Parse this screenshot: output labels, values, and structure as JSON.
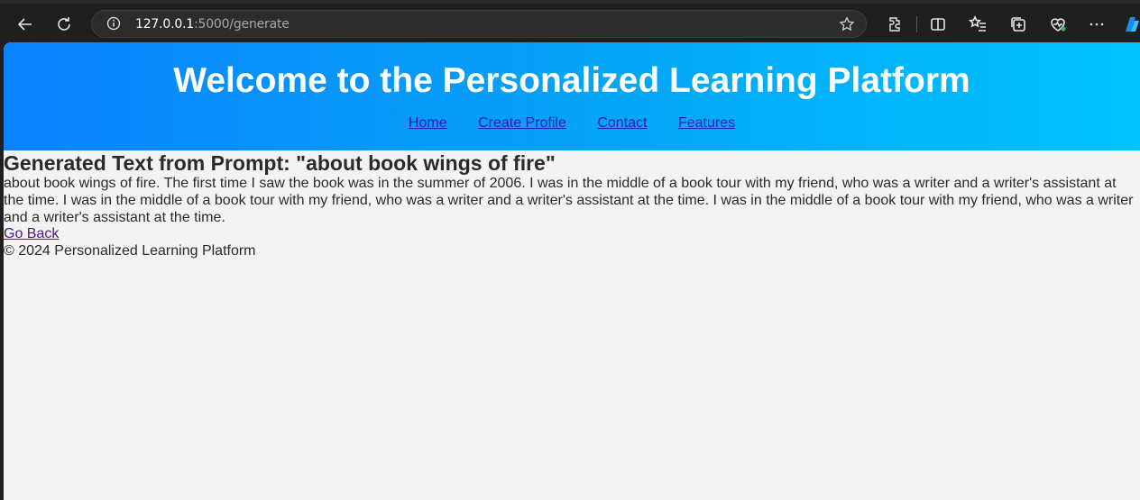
{
  "browser": {
    "url_host": "127.0.0.1",
    "url_rest": ":5000/generate"
  },
  "page": {
    "header_title": "Welcome to the Personalized Learning Platform",
    "nav": {
      "home": "Home",
      "create_profile": "Create Profile",
      "contact": "Contact",
      "features": "Features"
    },
    "heading": "Generated Text from Prompt: \"about book wings of fire\"",
    "generated_text": "about book wings of fire. The first time I saw the book was in the summer of 2006. I was in the middle of a book tour with my friend, who was a writer and a writer's assistant at the time. I was in the middle of a book tour with my friend, who was a writer and a writer's assistant at the time. I was in the middle of a book tour with my friend, who was a writer and a writer's assistant at the time.",
    "back_link": "Go Back",
    "footer": "© 2024 Personalized Learning Platform"
  }
}
